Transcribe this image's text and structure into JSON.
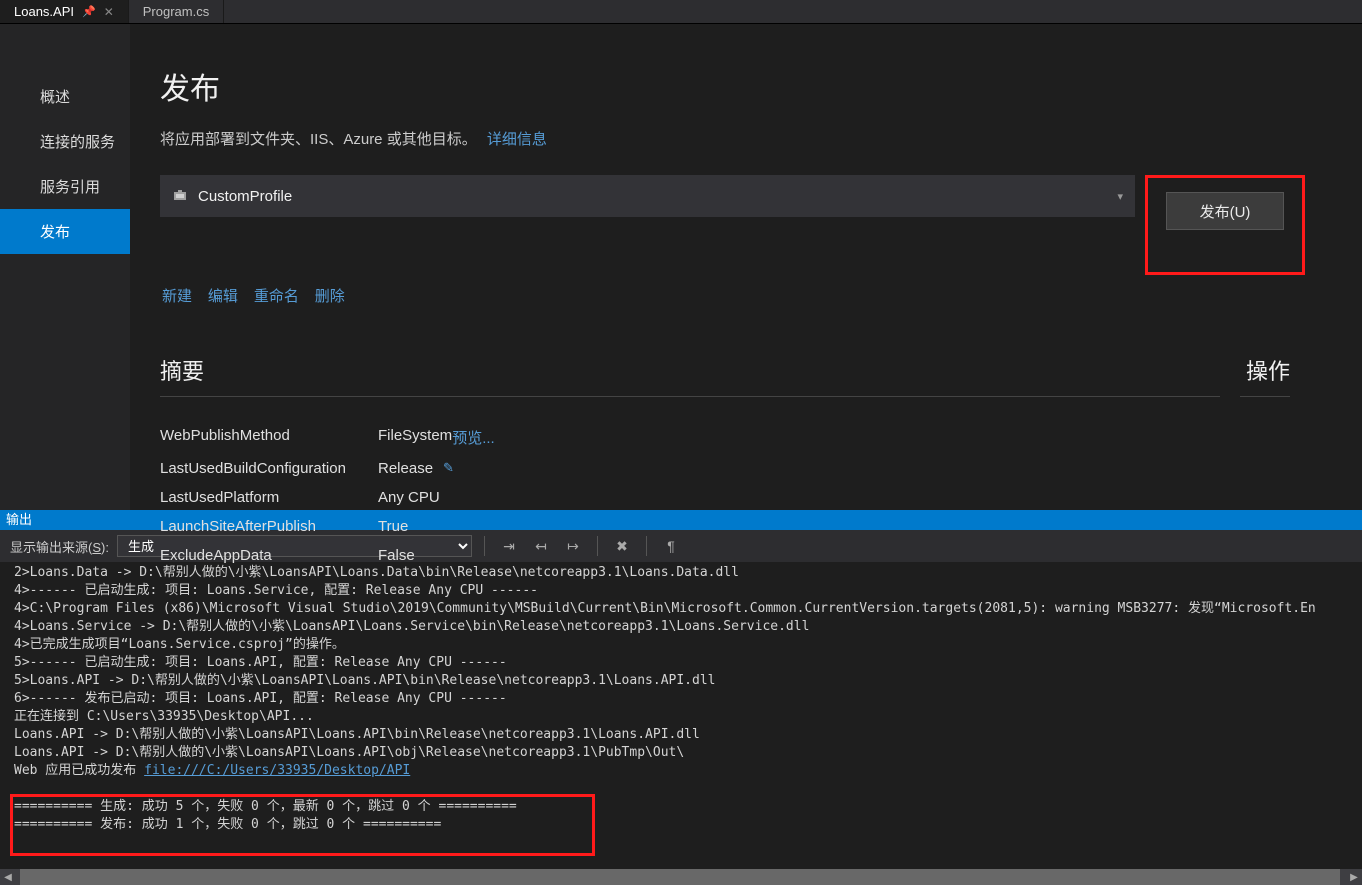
{
  "tabs": [
    {
      "label": "Loans.API",
      "pinned": true,
      "active": true
    },
    {
      "label": "Program.cs",
      "pinned": false,
      "active": false
    }
  ],
  "leftnav": {
    "items": [
      "概述",
      "连接的服务",
      "服务引用",
      "发布"
    ],
    "active": 3
  },
  "publish": {
    "heading": "发布",
    "subtitle": "将应用部署到文件夹、IIS、Azure 或其他目标。",
    "details_link": "详细信息",
    "profile": "CustomProfile",
    "button": "发布(U)",
    "links": [
      "新建",
      "编辑",
      "重命名",
      "删除"
    ]
  },
  "summary": {
    "heading": "摘要",
    "actions_heading": "操作",
    "preview": "预览...",
    "rows": [
      {
        "k": "WebPublishMethod",
        "v": "FileSystem",
        "edit": false
      },
      {
        "k": "LastUsedBuildConfiguration",
        "v": "Release",
        "edit": true
      },
      {
        "k": "LastUsedPlatform",
        "v": "Any CPU",
        "edit": false
      },
      {
        "k": "LaunchSiteAfterPublish",
        "v": "True",
        "edit": false
      },
      {
        "k": "ExcludeAppData",
        "v": "False",
        "edit": false
      }
    ]
  },
  "output": {
    "title": "输出",
    "source_label_pre": "显示输出来源(",
    "source_label_u": "S",
    "source_label_post": "):",
    "source_value": "生成",
    "link_text": "file:///C:/Users/33935/Desktop/API",
    "lines_pre": "2>Loans.Data -> D:\\帮别人做的\\小紫\\LoansAPI\\Loans.Data\\bin\\Release\\netcoreapp3.1\\Loans.Data.dll\n4>------ 已启动生成: 项目: Loans.Service, 配置: Release Any CPU ------\n4>C:\\Program Files (x86)\\Microsoft Visual Studio\\2019\\Community\\MSBuild\\Current\\Bin\\Microsoft.Common.CurrentVersion.targets(2081,5): warning MSB3277: 发现“Microsoft.En\n4>Loans.Service -> D:\\帮别人做的\\小紫\\LoansAPI\\Loans.Service\\bin\\Release\\netcoreapp3.1\\Loans.Service.dll\n4>已完成生成项目“Loans.Service.csproj”的操作。\n5>------ 已启动生成: 项目: Loans.API, 配置: Release Any CPU ------\n5>Loans.API -> D:\\帮别人做的\\小紫\\LoansAPI\\Loans.API\\bin\\Release\\netcoreapp3.1\\Loans.API.dll\n6>------ 发布已启动: 项目: Loans.API, 配置: Release Any CPU ------\n正在连接到 C:\\Users\\33935\\Desktop\\API...\nLoans.API -> D:\\帮别人做的\\小紫\\LoansAPI\\Loans.API\\bin\\Release\\netcoreapp3.1\\Loans.API.dll\nLoans.API -> D:\\帮别人做的\\小紫\\LoansAPI\\Loans.API\\obj\\Release\\netcoreapp3.1\\PubTmp\\Out\\\nWeb 应用已成功发布 ",
    "lines_post": "\n\n========== 生成: 成功 5 个，失败 0 个，最新 0 个，跳过 0 个 ==========\n========== 发布: 成功 1 个，失败 0 个，跳过 0 个 ==========\n"
  }
}
